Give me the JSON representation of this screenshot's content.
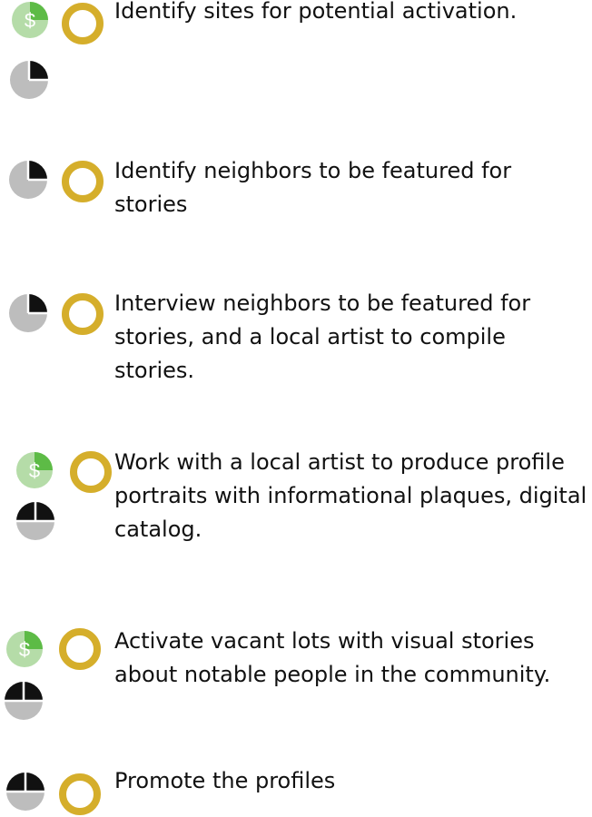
{
  "steps": [
    {
      "text": "Identify sites for potential activation.",
      "cost_icon": "dollar-pie-icon",
      "time_icon": "quarter-clock-pie-icon",
      "status_icon": "open-circle-icon"
    },
    {
      "text": "Identify neighbors to be featured for stories",
      "time_icon": "quarter-clock-pie-icon",
      "status_icon": "open-circle-icon"
    },
    {
      "text": "Interview neighbors to be featured for stories, and a local artist to compile stories.",
      "time_icon": "quarter-clock-pie-icon",
      "status_icon": "open-circle-icon"
    },
    {
      "text": "Work with a local artist to produce profile portraits with  informational plaques, digital catalog.",
      "cost_icon": "dollar-pie-icon",
      "time_icon": "half-clock-pie-icon",
      "status_icon": "open-circle-icon"
    },
    {
      "text": "Activate vacant lots with visual stories about notable people in the community.",
      "cost_icon": "dollar-pie-icon",
      "time_icon": "half-clock-pie-icon",
      "status_icon": "open-circle-icon"
    },
    {
      "text": "Promote the profiles",
      "time_icon": "half-clock-pie-icon",
      "status_icon": "open-circle-icon"
    }
  ],
  "colors": {
    "cost_green": "#5dbb46",
    "cost_light": "#b5dca8",
    "time_dark": "#111111",
    "time_light": "#bdbdbd",
    "status_ring": "#d5ae2b",
    "text": "#111111"
  }
}
